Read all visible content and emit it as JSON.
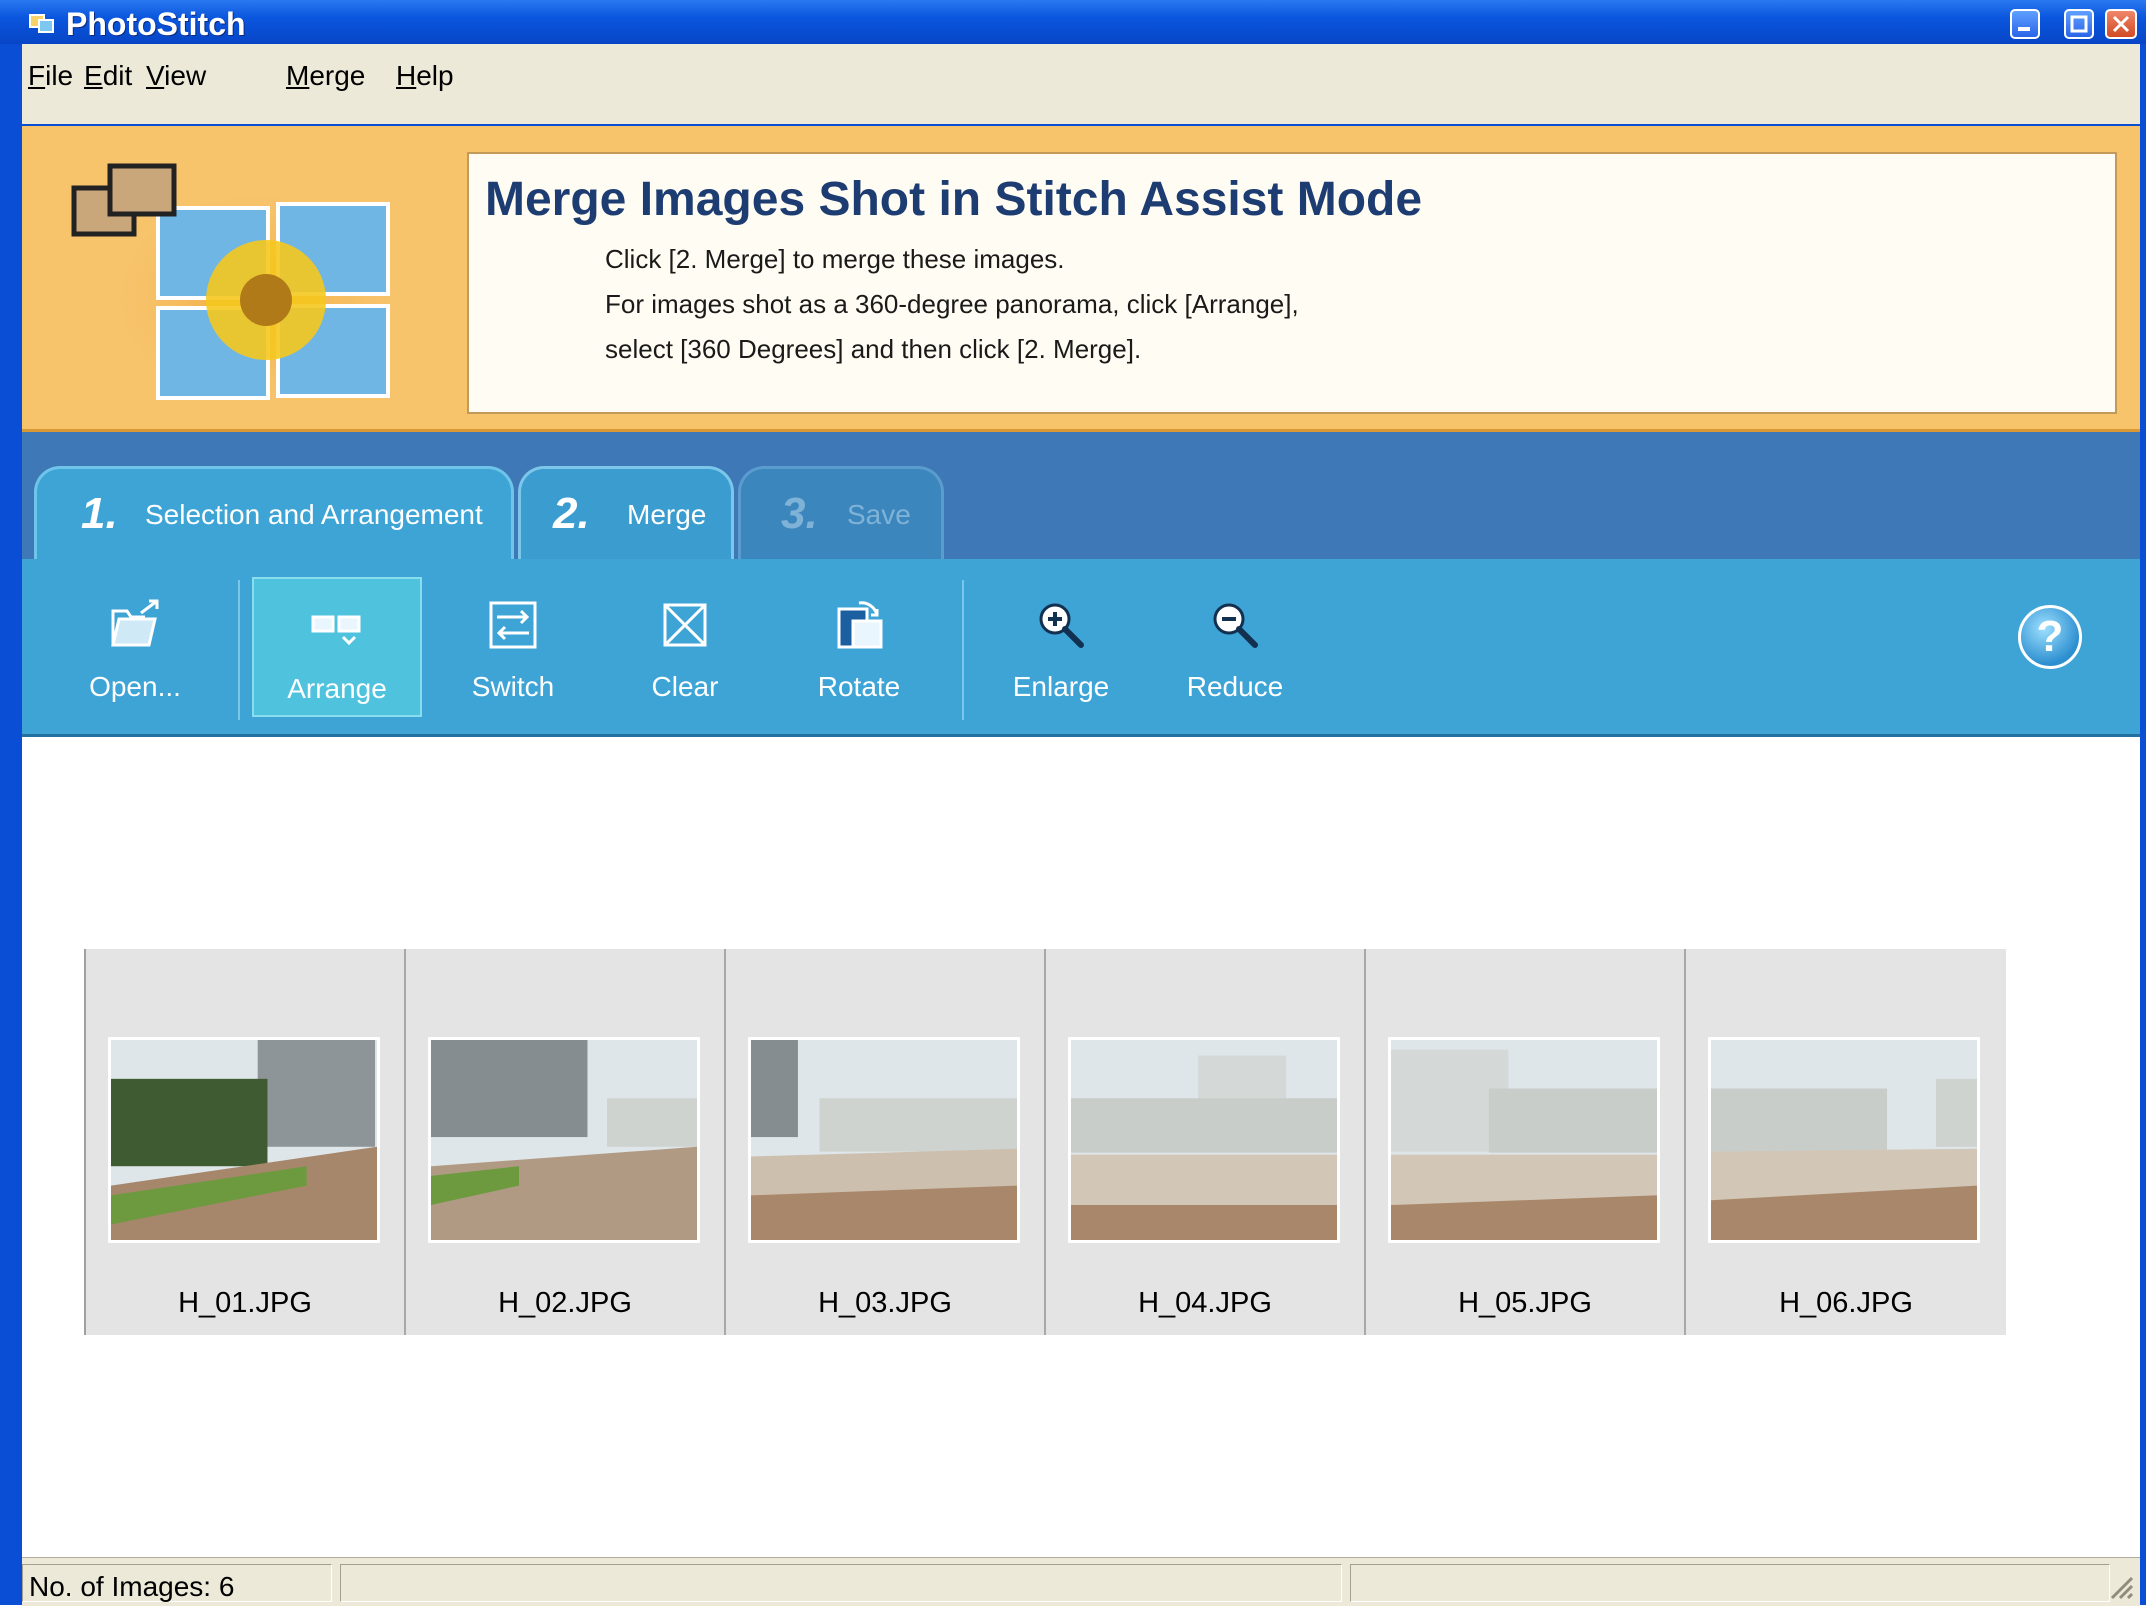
{
  "window": {
    "title": "PhotoStitch"
  },
  "menu": [
    "File",
    "Edit",
    "View",
    "Merge",
    "Help"
  ],
  "banner": {
    "title": "Merge Images Shot in Stitch Assist Mode",
    "lines": [
      "Click [2.  Merge] to merge these images.",
      "For images shot as a 360-degree panorama, click [Arrange],",
      "select [360 Degrees] and then click [2. Merge]."
    ]
  },
  "tabs": [
    {
      "num": "1.",
      "label": "Selection and Arrangement",
      "state": "active"
    },
    {
      "num": "2.",
      "label": "Merge",
      "state": "enabled"
    },
    {
      "num": "3.",
      "label": "Save",
      "state": "disabled"
    }
  ],
  "toolbar": {
    "open": "Open...",
    "arrange": "Arrange",
    "switch": "Switch",
    "clear": "Clear",
    "rotate": "Rotate",
    "enlarge": "Enlarge",
    "reduce": "Reduce",
    "help": "?"
  },
  "images": [
    "H_01.JPG",
    "H_02.JPG",
    "H_03.JPG",
    "H_04.JPG",
    "H_05.JPG",
    "H_06.JPG"
  ],
  "status": {
    "count": "No. of Images: 6"
  },
  "colors": {
    "titlebar": "#0a56de",
    "banner": "#f7c46c",
    "toolbar": "#3ea4d6",
    "tabband": "#3e78b6"
  }
}
